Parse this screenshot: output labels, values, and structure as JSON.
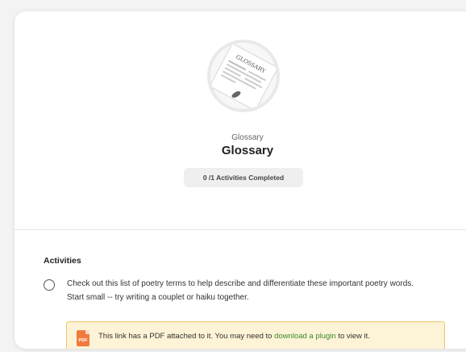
{
  "unit": {
    "thumbnail_icon": "glossary-document-image",
    "thumbnail_text": "GLOSSARY",
    "subtitle": "Glossary",
    "title": "Glossary",
    "progress": {
      "completed": 0,
      "total": 1,
      "label": "0 /1 Activities Completed"
    }
  },
  "activities": {
    "section_title": "Activities",
    "items": [
      {
        "description": "Check out this list of poetry terms to help describe and differentiate these important poetry words. Start small -- try writing a couplet or haiku together.",
        "completed": false,
        "notice": {
          "icon": "pdf-icon",
          "icon_text": "PDF",
          "text_before": "This link has a PDF attached to it. You may need to ",
          "link_label": "download a plugin",
          "text_after": " to view it."
        }
      }
    ]
  },
  "colors": {
    "link": "#3c8a2e",
    "notice_bg": "#fdf3d6",
    "notice_border": "#f1c46a",
    "pdf_icon": "#f07b3f"
  }
}
